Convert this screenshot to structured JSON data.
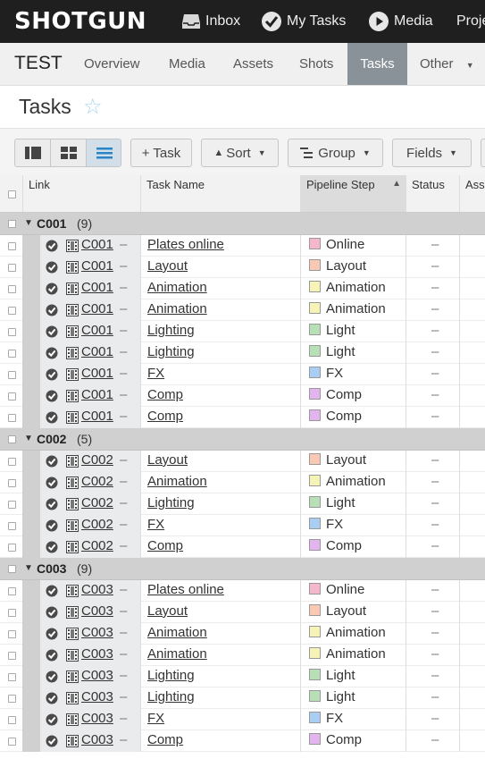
{
  "app": {
    "logo": "SHOTGUN",
    "nav": [
      {
        "label": "Inbox"
      },
      {
        "label": "My Tasks"
      },
      {
        "label": "Media"
      },
      {
        "label": "Proje"
      }
    ]
  },
  "project": {
    "name": "TEST",
    "tabs": [
      "Overview",
      "Media",
      "Assets",
      "Shots",
      "Tasks",
      "Other"
    ],
    "active_tab": "Tasks"
  },
  "page": {
    "title": "Tasks"
  },
  "toolbar": {
    "task_label": "+ Task",
    "sort_label": "Sort",
    "group_label": "Group",
    "fields_label": "Fields"
  },
  "table": {
    "headers": {
      "link": "Link",
      "task_name": "Task Name",
      "pipeline_step": "Pipeline Step",
      "status": "Status",
      "assigned": "Ass"
    },
    "groups": [
      {
        "name": "C001",
        "count": "(9)",
        "rows": [
          {
            "shot": "C001",
            "task": "Plates online",
            "step": "Online"
          },
          {
            "shot": "C001",
            "task": "Layout",
            "step": "Layout"
          },
          {
            "shot": "C001",
            "task": "Animation",
            "step": "Animation"
          },
          {
            "shot": "C001",
            "task": "Animation",
            "step": "Animation"
          },
          {
            "shot": "C001",
            "task": "Lighting",
            "step": "Light"
          },
          {
            "shot": "C001",
            "task": "Lighting",
            "step": "Light"
          },
          {
            "shot": "C001",
            "task": "FX",
            "step": "FX"
          },
          {
            "shot": "C001",
            "task": "Comp",
            "step": "Comp"
          },
          {
            "shot": "C001",
            "task": "Comp",
            "step": "Comp"
          }
        ]
      },
      {
        "name": "C002",
        "count": "(5)",
        "rows": [
          {
            "shot": "C002",
            "task": "Layout",
            "step": "Layout"
          },
          {
            "shot": "C002",
            "task": "Animation",
            "step": "Animation"
          },
          {
            "shot": "C002",
            "task": "Lighting",
            "step": "Light"
          },
          {
            "shot": "C002",
            "task": "FX",
            "step": "FX"
          },
          {
            "shot": "C002",
            "task": "Comp",
            "step": "Comp"
          }
        ]
      },
      {
        "name": "C003",
        "count": "(9)",
        "rows": [
          {
            "shot": "C003",
            "task": "Plates online",
            "step": "Online"
          },
          {
            "shot": "C003",
            "task": "Layout",
            "step": "Layout"
          },
          {
            "shot": "C003",
            "task": "Animation",
            "step": "Animation"
          },
          {
            "shot": "C003",
            "task": "Animation",
            "step": "Animation"
          },
          {
            "shot": "C003",
            "task": "Lighting",
            "step": "Light"
          },
          {
            "shot": "C003",
            "task": "Lighting",
            "step": "Light"
          },
          {
            "shot": "C003",
            "task": "FX",
            "step": "FX"
          },
          {
            "shot": "C003",
            "task": "Comp",
            "step": "Comp"
          }
        ]
      }
    ],
    "placeholder_dash": "–"
  },
  "step_colors": {
    "Online": "#f5b8cb",
    "Layout": "#f9c9b3",
    "Animation": "#f6f3b6",
    "Light": "#b8e0b6",
    "FX": "#a9cdf3",
    "Comp": "#e2b5ef"
  }
}
